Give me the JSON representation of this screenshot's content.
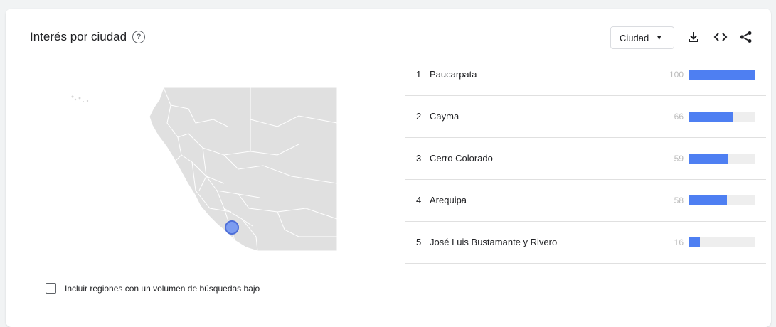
{
  "header": {
    "title": "Interés por ciudad",
    "help_icon": "?",
    "select_value": "Ciudad",
    "icons": [
      "help-icon",
      "download-icon",
      "embed-code-icon",
      "share-icon"
    ]
  },
  "ranking": {
    "items": [
      {
        "rank": "1",
        "name": "Paucarpata",
        "value": "100",
        "level": 100
      },
      {
        "rank": "2",
        "name": "Cayma",
        "value": "66",
        "level": 66
      },
      {
        "rank": "3",
        "name": "Cerro Colorado",
        "value": "59",
        "level": 59
      },
      {
        "rank": "4",
        "name": "Arequipa",
        "value": "58",
        "level": 58
      },
      {
        "rank": "5",
        "name": "José Luis Bustamante y Rivero",
        "value": "16",
        "level": 16
      }
    ],
    "bar_color": "#4e7ff2"
  },
  "footer": {
    "checkbox_label": "Incluir regiones con un volumen de búsquedas bajo",
    "checkbox_checked": false
  },
  "colors": {
    "accent": "#4e7ff2",
    "map_fill": "#e0e0e0",
    "marker": "#7c9cf0"
  }
}
